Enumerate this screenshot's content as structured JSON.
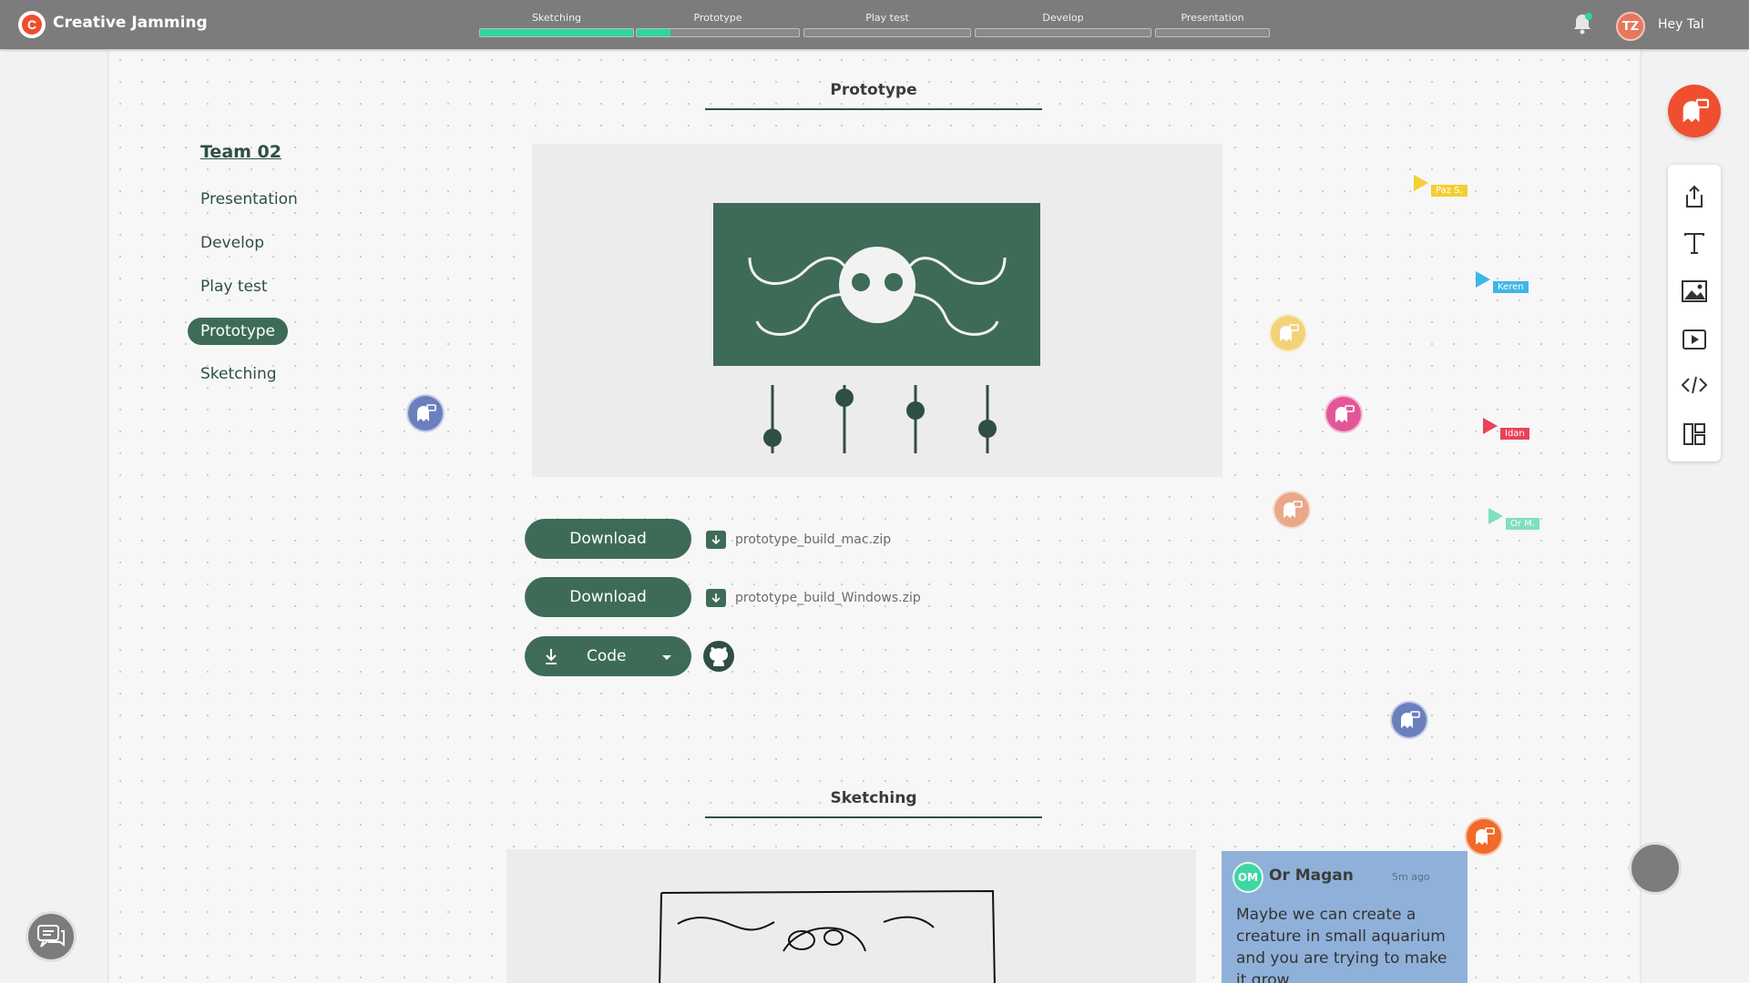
{
  "app": {
    "title": "Creative Jamming",
    "logo": "C"
  },
  "stages": [
    {
      "label": "Sketching",
      "progress": 1.0
    },
    {
      "label": "Prototype",
      "progress": 0.21
    },
    {
      "label": "Play test",
      "progress": 0
    },
    {
      "label": "Develop",
      "progress": 0
    },
    {
      "label": "Presentation",
      "progress": 0
    }
  ],
  "user": {
    "initials": "TZ",
    "greeting": "Hey Tal"
  },
  "sidebar": {
    "team": "Team 02",
    "items": [
      "Presentation",
      "Develop",
      "Play test",
      "Prototype",
      "Sketching"
    ],
    "active": "Prototype"
  },
  "prototype": {
    "title": "Prototype",
    "downloads": [
      {
        "button": "Download",
        "file": "prototype_build_mac.zip"
      },
      {
        "button": "Download",
        "file": "prototype_build_Windows.zip"
      }
    ],
    "code_button": "Code"
  },
  "sketching": {
    "title": "Sketching"
  },
  "comment": {
    "initials": "OM",
    "author": "Or Magan",
    "time": "5m ago",
    "text": "Maybe we can create a creature in small aquarium and you are trying to make it grow"
  },
  "cursors": [
    {
      "name": "Paz S.",
      "color": "#f3cf2f"
    },
    {
      "name": "Keren",
      "color": "#3fb6e8"
    },
    {
      "name": "Idan",
      "color": "#e8435a"
    },
    {
      "name": "Or M.",
      "color": "#7fe0bd"
    }
  ],
  "ghost_colors": {
    "blue": "#6b7fbf",
    "yellow": "#f3d27a",
    "pink": "#e2579a",
    "peach": "#e9a88a",
    "orange": "#f26a2a",
    "brand": "#ef4f2f"
  },
  "colors": {
    "accent": "#3e6b57",
    "progress": "#2fd69a"
  },
  "toolbar_icons": [
    "share-icon",
    "text-icon",
    "image-icon",
    "video-icon",
    "code-icon",
    "layout-icon"
  ]
}
